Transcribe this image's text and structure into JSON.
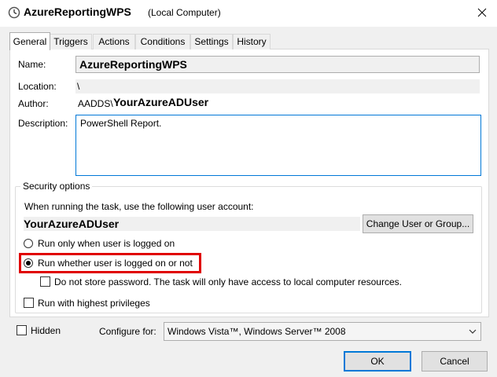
{
  "window": {
    "title": "AzureReportingWPS",
    "subtitle": "(Local Computer)",
    "icon": "clock-icon",
    "close_icon": "close-icon"
  },
  "tabs": [
    "General",
    "Triggers",
    "Actions",
    "Conditions",
    "Settings",
    "History"
  ],
  "general": {
    "name_label": "Name:",
    "name_value": "AzureReportingWPS",
    "location_label": "Location:",
    "location_value": "\\",
    "author_label": "Author:",
    "author_domain": "AADDS\\",
    "author_user": "YourAzureADUser",
    "description_label": "Description:",
    "description_value": "PowerShell Report."
  },
  "security": {
    "title": "Security options",
    "account_prompt": "When running the task, use the following user account:",
    "account_user": "YourAzureADUser",
    "change_button": "Change User or Group...",
    "radio_logged_on": "Run only when user is logged on",
    "radio_whether": "Run whether user is logged on or not",
    "selected_radio": "Run whether user is logged on or not",
    "do_not_store": "Do not store password.  The task will only have access to local computer resources.",
    "highest_privileges": "Run with highest privileges"
  },
  "bottom": {
    "hidden_label": "Hidden",
    "configure_label": "Configure for:",
    "configure_value": "Windows Vista™, Windows Server™ 2008"
  },
  "buttons": {
    "ok": "OK",
    "cancel": "Cancel"
  },
  "colors": {
    "highlight": "#e00000",
    "focus_border": "#0078d7"
  }
}
